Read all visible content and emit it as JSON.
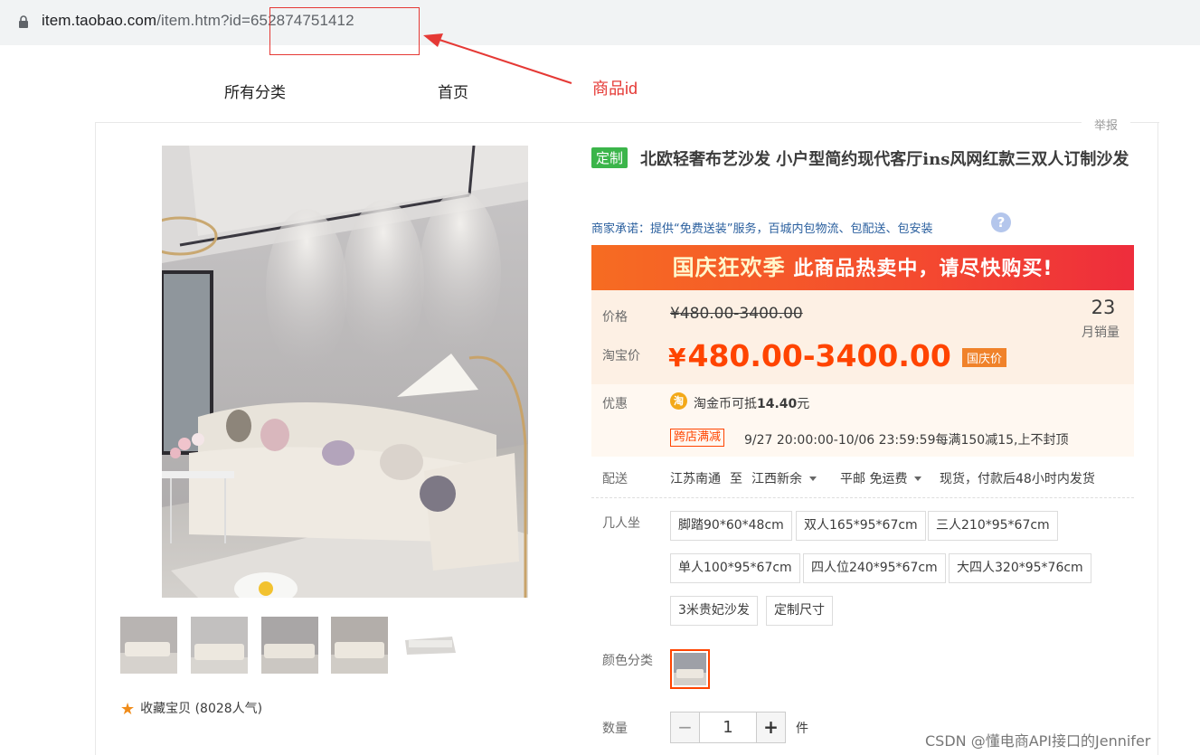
{
  "browser": {
    "url_host": "item.taobao.com",
    "url_path": "/item.htm?id=652874751412"
  },
  "annotation": {
    "label": "商品id",
    "color": "#e53935"
  },
  "shop_nav": {
    "items": [
      "所有分类",
      "首页"
    ]
  },
  "report_label": "举报",
  "product": {
    "tag": "定制",
    "title": "北欧轻奢布艺沙发 小户型简约现代客厅ins风网红款三双人订制沙发",
    "promise": "商家承诺：提供“免费送装”服务，百城内包物流、包配送、包安装",
    "help_icon": "?"
  },
  "banner": {
    "title": "国庆狂欢季",
    "subtitle": "此商品热卖中，请尽快购买!"
  },
  "price": {
    "label_price": "价格",
    "old_price": "¥480.00-3400.00",
    "label_tb": "淘宝价",
    "currency": "¥",
    "new_price": "480.00-3400.00",
    "tag": "国庆价",
    "sales_count": "23",
    "sales_label": "月销量"
  },
  "promo": {
    "label": "优惠",
    "coin_icon": "淘",
    "coin_text": "淘金币可抵",
    "coin_amount": "14.40",
    "coin_unit": "元",
    "store_tag": "跨店满减",
    "store_text": "9/27 20:00:00-10/06 23:59:59每满150减15,上不封顶"
  },
  "delivery": {
    "label": "配送",
    "from": "江苏南通",
    "to_word": "至",
    "to": "江西新余",
    "shipping": "平邮 免运费",
    "stock": "现货，付款后48小时内发货"
  },
  "seats": {
    "label": "几人坐",
    "options": [
      "脚踏90*60*48cm",
      "双人165*95*67cm",
      "三人210*95*67cm",
      "单人100*95*67cm",
      "四人位240*95*67cm",
      "大四人320*95*76cm",
      "3米贵妃沙发",
      "定制尺寸"
    ]
  },
  "color": {
    "label": "颜色分类"
  },
  "quantity": {
    "label": "数量",
    "minus": "−",
    "value": "1",
    "plus": "+",
    "unit": "件"
  },
  "favorite": {
    "text": "收藏宝贝 (8028人气)"
  },
  "watermark": "CSDN @懂电商API接口的Jennifer"
}
